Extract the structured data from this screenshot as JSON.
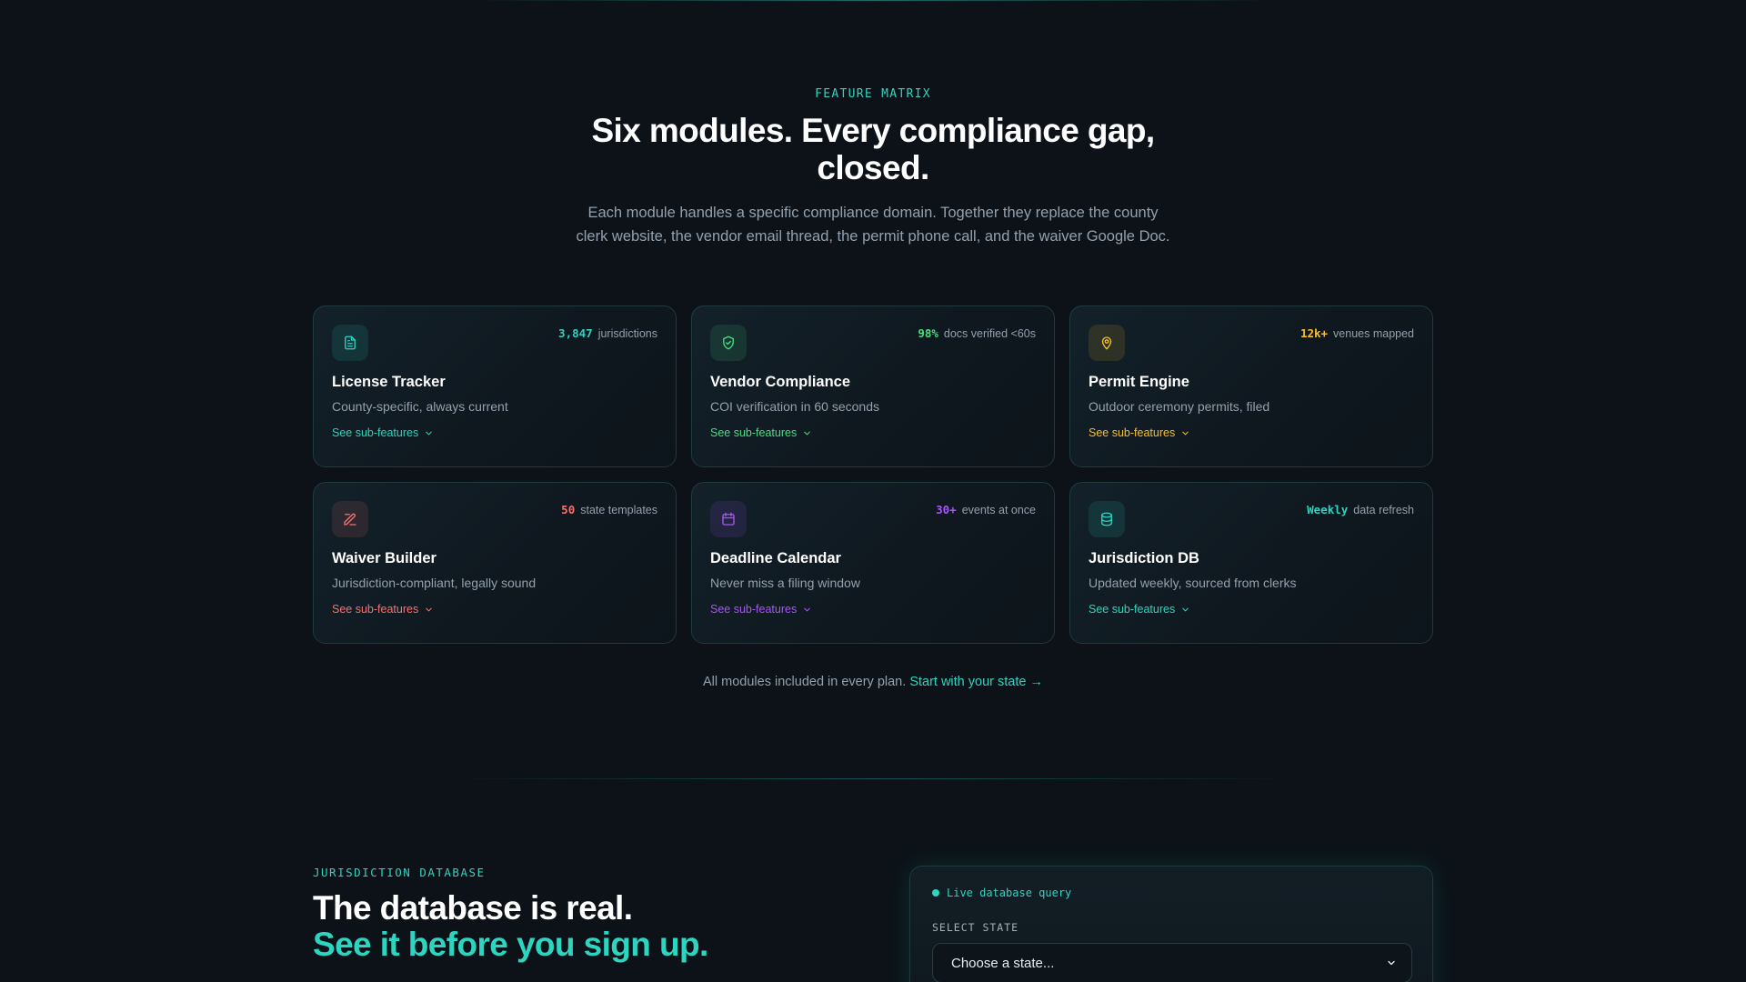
{
  "colors": {
    "teal": "#2dd4bf",
    "green": "#4ade80",
    "amber": "#fbbf24",
    "red": "#f87171",
    "purple": "#a855f7",
    "text_muted": "#93a0ad",
    "background": "#0c1218"
  },
  "features": {
    "eyebrow": "FEATURE MATRIX",
    "headline": "Six modules. Every compliance gap, closed.",
    "subtitle": "Each module handles a specific compliance domain. Together they replace the county clerk website, the vendor email thread, the permit phone call, and the waiver Google Doc.",
    "cards": [
      {
        "icon": "document-icon",
        "stat_value": "3,847",
        "stat_label": "jurisdictions",
        "title": "License Tracker",
        "description": "County-specific, always current",
        "link": "See sub-features",
        "color": "#2dd4bf"
      },
      {
        "icon": "shield-check-icon",
        "stat_value": "98%",
        "stat_label": "docs verified <60s",
        "title": "Vendor Compliance",
        "description": "COI verification in 60 seconds",
        "link": "See sub-features",
        "color": "#4ade80"
      },
      {
        "icon": "map-pin-icon",
        "stat_value": "12k+",
        "stat_label": "venues mapped",
        "title": "Permit Engine",
        "description": "Outdoor ceremony permits, filed",
        "link": "See sub-features",
        "color": "#fbbf24"
      },
      {
        "icon": "pen-edit-icon",
        "stat_value": "50",
        "stat_label": "state templates",
        "title": "Waiver Builder",
        "description": "Jurisdiction-compliant, legally sound",
        "link": "See sub-features",
        "color": "#f87171"
      },
      {
        "icon": "calendar-icon",
        "stat_value": "30+",
        "stat_label": "events at once",
        "title": "Deadline Calendar",
        "description": "Never miss a filing window",
        "link": "See sub-features",
        "color": "#a855f7"
      },
      {
        "icon": "database-icon",
        "stat_value": "Weekly",
        "stat_label": "data refresh",
        "title": "Jurisdiction DB",
        "description": "Updated weekly, sourced from clerks",
        "link": "See sub-features",
        "color": "#2dd4bf"
      }
    ],
    "footnote": "All modules included in every plan.",
    "footnote_link": "Start with your state →"
  },
  "database": {
    "eyebrow": "JURISDICTION DATABASE",
    "headline_line1": "The database is real.",
    "headline_line2": "See it before you sign up.",
    "panel": {
      "live_label": "Live database query",
      "select_label": "SELECT STATE",
      "select_placeholder": "Choose a state..."
    }
  }
}
